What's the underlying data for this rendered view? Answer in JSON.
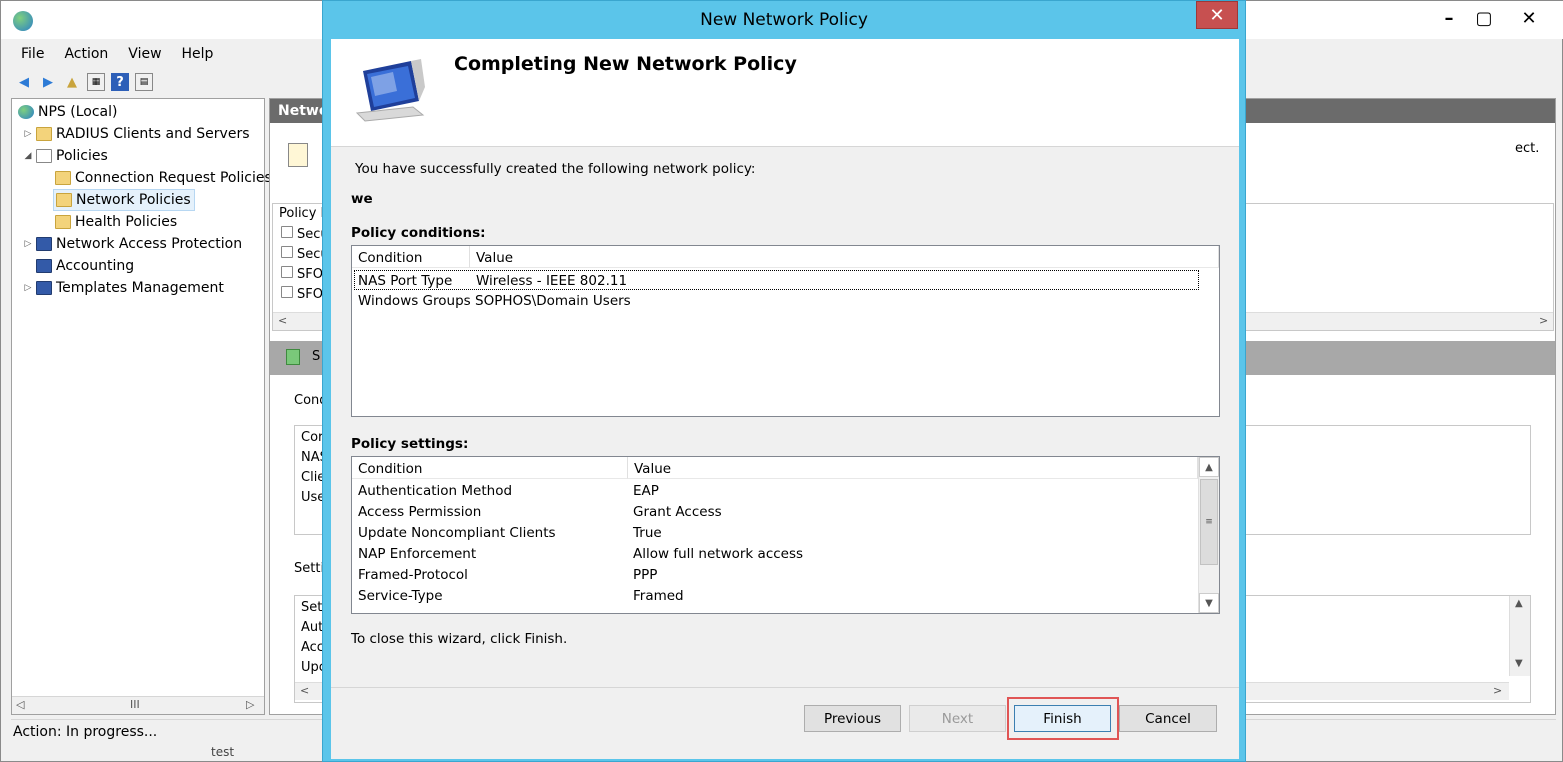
{
  "background_window": {
    "menu": [
      "File",
      "Action",
      "View",
      "Help"
    ],
    "tree": [
      {
        "label": "NPS (Local)",
        "icon": "nps-globe-icon"
      },
      {
        "label": "RADIUS Clients and Servers",
        "icon": "folder-icon"
      },
      {
        "label": "Policies",
        "icon": "policies-icon"
      },
      {
        "label": "Connection Request Policies",
        "icon": "folder-icon"
      },
      {
        "label": "Network Policies",
        "icon": "network-policies-icon"
      },
      {
        "label": "Health Policies",
        "icon": "folder-icon"
      },
      {
        "label": "Network Access Protection",
        "icon": "nap-icon"
      },
      {
        "label": "Accounting",
        "icon": "accounting-icon"
      },
      {
        "label": "Templates Management",
        "icon": "templates-icon"
      }
    ],
    "right_header": "Netwo",
    "right_desc_tail": "ect.",
    "list_header": "Policy N",
    "list_rows": [
      "Secu",
      "Secu",
      "SFO",
      "SFO"
    ],
    "band_text": "S",
    "group1_label": "Cond",
    "group1_rows": [
      "Cor",
      "NAS",
      "Clie",
      "Use"
    ],
    "group2_label": "Settin",
    "group2_rows": [
      "Set",
      "Auth",
      "Acc",
      "Upc"
    ],
    "tree_scroll_mid": "III",
    "status": "Action:  In progress...",
    "bottom_tail": "test"
  },
  "dialog": {
    "title": "New Network Policy",
    "heading": "Completing New Network Policy",
    "intro": "You have successfully created the following network policy:",
    "policy_name": "we",
    "conditions_label": "Policy conditions:",
    "conditions_columns": [
      "Condition",
      "Value"
    ],
    "conditions": [
      {
        "condition": "NAS Port Type",
        "value": "Wireless - IEEE 802.11"
      },
      {
        "condition": "Windows Groups",
        "value": "SOPHOS\\Domain Users"
      }
    ],
    "settings_label": "Policy settings:",
    "settings_columns": [
      "Condition",
      "Value"
    ],
    "settings": [
      {
        "condition": "Authentication Method",
        "value": "EAP"
      },
      {
        "condition": "Access Permission",
        "value": "Grant Access"
      },
      {
        "condition": "Update Noncompliant Clients",
        "value": "True"
      },
      {
        "condition": "NAP Enforcement",
        "value": "Allow full network access"
      },
      {
        "condition": "Framed-Protocol",
        "value": "PPP"
      },
      {
        "condition": "Service-Type",
        "value": "Framed"
      }
    ],
    "close_text": "To close this wizard, click Finish.",
    "buttons": {
      "previous": "Previous",
      "next": "Next",
      "finish": "Finish",
      "cancel": "Cancel"
    },
    "highlight_color": "#e05555"
  }
}
